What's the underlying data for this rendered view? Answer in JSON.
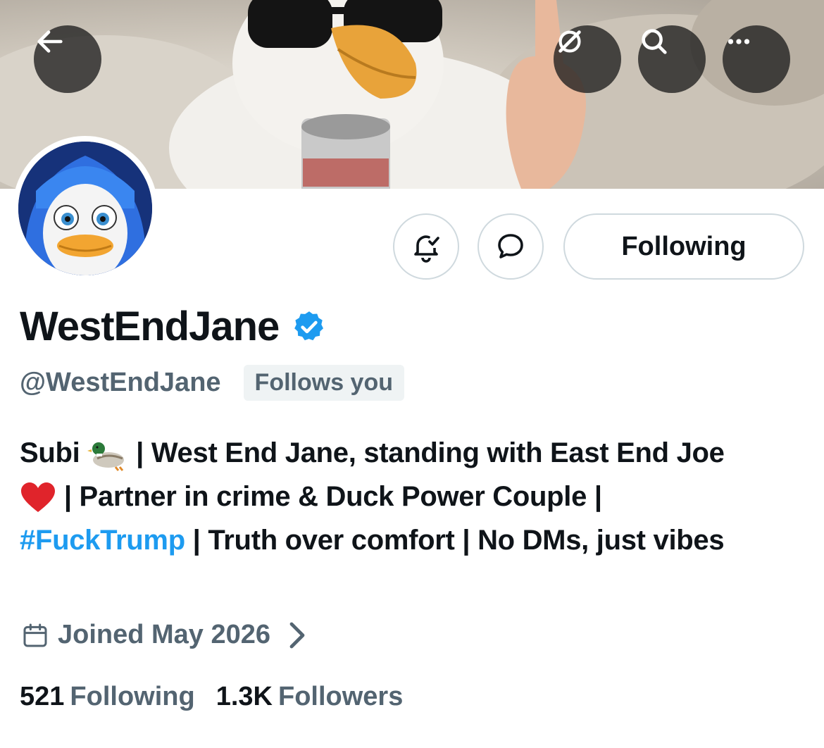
{
  "header": {
    "back_icon": "arrow-left-icon",
    "grok_icon": "grok-icon",
    "search_icon": "search-icon",
    "more_icon": "more-horizontal-icon"
  },
  "profile": {
    "display_name": "WestEndJane",
    "handle": "@WestEndJane",
    "follows_you": "Follows you",
    "verified": true,
    "verified_color": "#1d9bf0",
    "actions": {
      "notify_icon": "bell-check-icon",
      "message_icon": "message-bubble-icon",
      "follow_label": "Following"
    },
    "bio": {
      "part1": "Subi",
      "part2": " | West End Jane, standing with East End Joe",
      "part3": " | Partner in crime & Duck Power Couple |",
      "hashtag": "#FuckTrump",
      "part4": " | Truth over comfort | No DMs, just vibes"
    },
    "joined": "Joined May 2026",
    "stats": {
      "following_count": "521",
      "following_label": "Following",
      "followers_count": "1.3K",
      "followers_label": "Followers"
    }
  },
  "colors": {
    "accent": "#1d9bf0",
    "text_primary": "#0f1419",
    "text_secondary": "#536471",
    "border": "#cfd9de"
  }
}
